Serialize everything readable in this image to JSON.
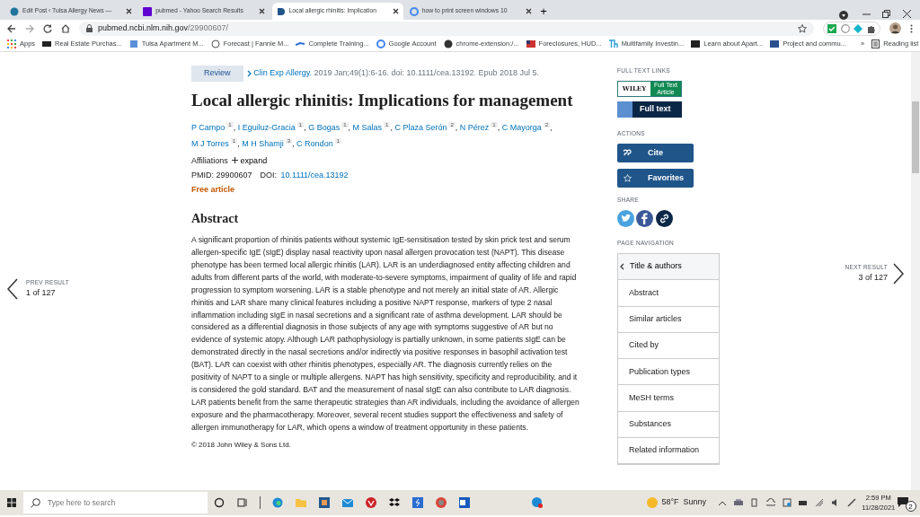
{
  "browser": {
    "tabs": [
      {
        "title": "Edit Post ‹ Tulsa Allergy News —",
        "selected": false,
        "kind": "wp"
      },
      {
        "title": "pubmed - Yahoo Search Results",
        "selected": false,
        "kind": "yahoo"
      },
      {
        "title": "Local allergic rhinitis: Implication",
        "selected": true,
        "kind": "pubmed"
      },
      {
        "title": "how to print screen windows 10",
        "selected": false,
        "kind": "google"
      }
    ],
    "new_tab": "+",
    "url": {
      "host": "pubmed.ncbi.nlm.nih.gov",
      "path": "/29900607/"
    },
    "bookmarks": [
      {
        "label": "Apps"
      },
      {
        "label": "Real Estate Purchas..."
      },
      {
        "label": "Tulsa Apartment M..."
      },
      {
        "label": "Forecast | Fannie M..."
      },
      {
        "label": "Complete Training..."
      },
      {
        "label": "Google Account"
      },
      {
        "label": "chrome-extension:/..."
      },
      {
        "label": "Foreclosures, HUD..."
      },
      {
        "label": "Multifamily Investin..."
      },
      {
        "label": "Learn about Apart..."
      },
      {
        "label": "Project and commu..."
      }
    ],
    "bookmarks_more": "»",
    "reading_list": "Reading list"
  },
  "prev": {
    "label": "PREV RESULT",
    "count": "1 of 127"
  },
  "next": {
    "label": "NEXT RESULT",
    "count": "3 of 127"
  },
  "article": {
    "badge": "Review",
    "journal": "Clin Exp Allergy.",
    "citation": "2019 Jan;49(1):6-16. doi: 10.1111/cea.13192. Epub 2018 Jul 5.",
    "title": "Local allergic rhinitis: Implications for management",
    "authors": [
      {
        "name": "P Campo",
        "aff": "1",
        "sep": ","
      },
      {
        "name": "I Eguiluz-Gracia",
        "aff": "1",
        "sep": ","
      },
      {
        "name": "G Bogas",
        "aff": "1",
        "sep": ","
      },
      {
        "name": "M Salas",
        "aff": "1",
        "sep": ","
      },
      {
        "name": "C Plaza Serón",
        "aff": "2",
        "sep": ","
      },
      {
        "name": "N Pérez",
        "aff": "1",
        "sep": ","
      },
      {
        "name": "C Mayorga",
        "aff": "2",
        "sep": ","
      },
      {
        "name": "M J Torres",
        "aff": "1",
        "sep": ","
      },
      {
        "name": "M H Shamji",
        "aff": "3",
        "sep": ","
      },
      {
        "name": "C Rondon",
        "aff": "1"
      }
    ],
    "affiliations_label": "Affiliations",
    "expand": "expand",
    "pmid_label": "PMID:",
    "pmid": "29900607",
    "doi_label": "DOI:",
    "doi": "10.1111/cea.13192",
    "free": "Free article",
    "abstract_heading": "Abstract",
    "abstract": "A significant proportion of rhinitis patients without systemic IgE-sensitisation tested by skin prick test and serum allergen-specific IgE (sIgE) display nasal reactivity upon nasal allergen provocation test (NAPT). This disease phenotype has been termed local allergic rhinitis (LAR). LAR is an underdiagnosed entity affecting children and adults from different parts of the world, with moderate-to-severe symptoms, impairment of quality of life and rapid progression to symptom worsening. LAR is a stable phenotype and not merely an initial state of AR. Allergic rhinitis and LAR share many clinical features including a positive NAPT response, markers of type 2 nasal inflammation including sIgE in nasal secretions and a significant rate of asthma development. LAR should be considered as a differential diagnosis in those subjects of any age with symptoms suggestive of AR but no evidence of systemic atopy. Although LAR pathophysiology is partially unknown, in some patients sIgE can be demonstrated directly in the nasal secretions and/or indirectly via positive responses in basophil activation test (BAT). LAR can coexist with other rhinitis phenotypes, especially AR. The diagnosis currently relies on the positivity of NAPT to a single or multiple allergens. NAPT has high sensitivity, specificity and reproducibility, and it is considered the gold standard. BAT and the measurement of nasal sIgE can also contribute to LAR diagnosis. LAR patients benefit from the same therapeutic strategies than AR individuals, including the avoidance of allergen exposure and the pharmacotherapy. Moreover, several recent studies support the effectiveness and safety of allergen immunotherapy for LAR, which opens a window of treatment opportunity in these patients.",
    "copyright": "© 2018 John Wiley & Sons Ltd."
  },
  "sidebar": {
    "full_text_heading": "FULL TEXT LINKS",
    "links": [
      {
        "kind": "wiley",
        "brand": "WILEY",
        "label": "Full Text Article"
      },
      {
        "kind": "fulltext",
        "label": "Full text"
      }
    ],
    "actions_heading": "ACTIONS",
    "actions": [
      {
        "kind": "cite",
        "label": "Cite"
      },
      {
        "kind": "favorites",
        "label": "Favorites"
      }
    ],
    "share_heading": "SHARE",
    "nav_heading": "PAGE NAVIGATION",
    "nav": [
      {
        "label": "Title & authors",
        "selected": true
      },
      {
        "label": "Abstract",
        "selected": false
      },
      {
        "label": "Similar articles",
        "selected": false
      },
      {
        "label": "Cited by",
        "selected": false
      },
      {
        "label": "Publication types",
        "selected": false
      },
      {
        "label": "MeSH terms",
        "selected": false
      },
      {
        "label": "Substances",
        "selected": false
      },
      {
        "label": "Related information",
        "selected": false
      }
    ]
  },
  "taskbar": {
    "search_placeholder": "Type here to search",
    "weather": "58°F  Sunny",
    "time": "2:59 PM",
    "date": "11/28/2021",
    "notifications": "2"
  }
}
